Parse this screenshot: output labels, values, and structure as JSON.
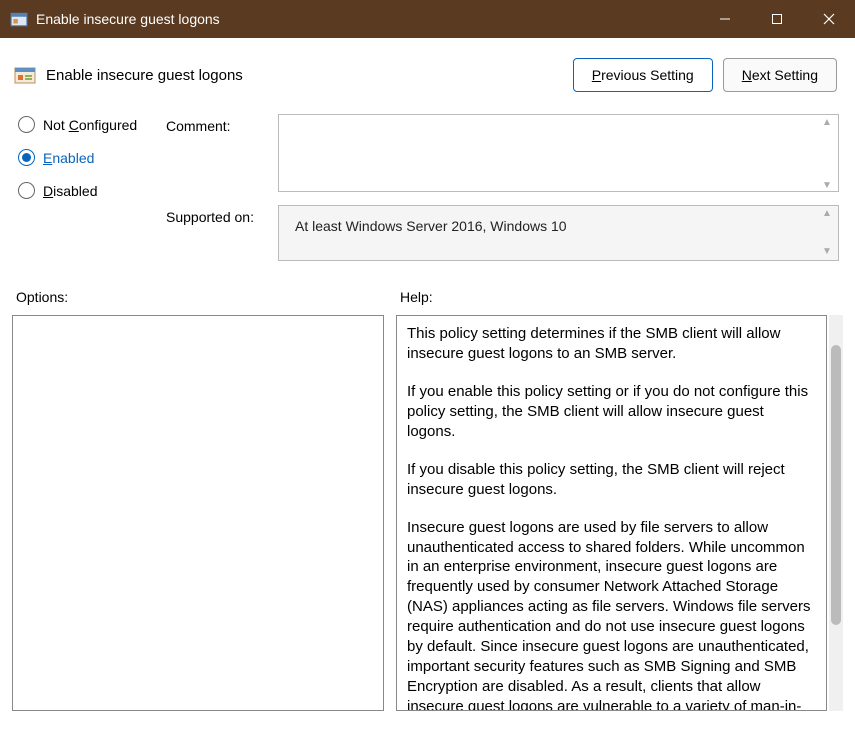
{
  "window": {
    "title": "Enable insecure guest logons"
  },
  "header": {
    "title": "Enable insecure guest logons"
  },
  "nav": {
    "previous_label_pre": "P",
    "previous_label_rest": "revious Setting",
    "next_label_pre": "N",
    "next_label_rest": "ext Setting"
  },
  "radio": {
    "not_configured_pre": "Not ",
    "not_configured_mn": "C",
    "not_configured_rest": "onfigured",
    "enabled_mn": "E",
    "enabled_rest": "nabled",
    "disabled_mn": "D",
    "disabled_rest": "isabled",
    "selected": "enabled"
  },
  "fields": {
    "comment_label": "Comment:",
    "comment_value": "",
    "supported_label": "Supported on:",
    "supported_value": "At least Windows Server 2016, Windows 10"
  },
  "panels": {
    "options_label": "Options:",
    "help_label": "Help:"
  },
  "help_text": {
    "p1": "This policy setting determines if the SMB client will allow insecure guest logons to an SMB server.",
    "p2": "If you enable this policy setting or if you do not configure this policy setting, the SMB client will allow insecure guest logons.",
    "p3": "If you disable this policy setting, the SMB client will reject insecure guest logons.",
    "p4": "Insecure guest logons are used by file servers to allow unauthenticated access to shared folders. While uncommon in an enterprise environment, insecure guest logons are frequently used by consumer Network Attached Storage (NAS) appliances acting as file servers. Windows file servers require authentication and do not use insecure guest logons by default. Since insecure guest logons are unauthenticated, important security features such as SMB Signing and SMB Encryption are disabled. As a result, clients that allow insecure guest logons are vulnerable to a variety of man-in-the-middle attacks that can result in data loss, data corruption, and exposure to malware. Additionally, any data"
  }
}
